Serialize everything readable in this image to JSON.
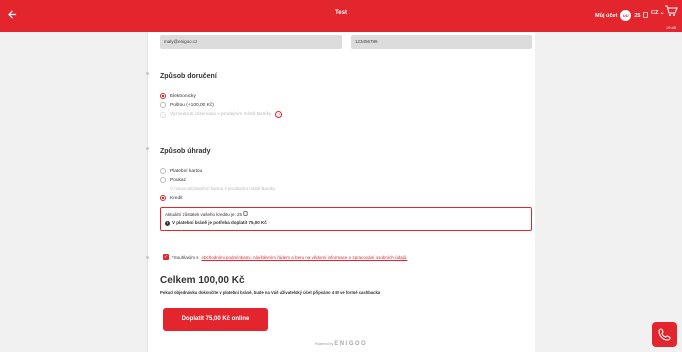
{
  "topbar": {
    "back_icon": "arrow-left-icon",
    "title": "Test",
    "account_label": "Můj účet",
    "avatar_initials": "UU",
    "credit": "25",
    "credit_icon": "credit-coin-icon",
    "language": "CZ",
    "cart_icon": "cart-icon",
    "cart_time": "19:48"
  },
  "contact": {
    "email": "maly@enigoo.cz",
    "phone": "123456789"
  },
  "delivery": {
    "title": "Způsob doručení",
    "options": [
      {
        "label": "Elektronicky",
        "selected": true,
        "disabled": false
      },
      {
        "label": "Poštou (+100,00 Kč)",
        "selected": false,
        "disabled": false
      },
      {
        "label": "Vyzvednutí rezervace v prodejním místě Baníky",
        "selected": false,
        "disabled": true
      }
    ]
  },
  "payment": {
    "title": "Způsob úhrady",
    "options": [
      {
        "label": "Platební kartou",
        "selected": false,
        "disabled": false
      },
      {
        "label": "Poukaz",
        "selected": false,
        "disabled": false
      },
      {
        "label": "V hotovosti/platební kartou v prodejním místě Baníky",
        "selected": false,
        "disabled": true
      },
      {
        "label": "Kredit",
        "selected": true,
        "disabled": false
      }
    ],
    "credit_balance_text": "Aktuální zůstatek vašeho kreditu je: 25",
    "credit_warning": "V platební bráně je potřeba doplatit 75,00 Kč"
  },
  "consent": {
    "prefix": "*Souhlasím s ",
    "link_text": "obchodními podmínkami, návštěvním řádem a beru na vědomí informace o zpracování osobních údajů.",
    "checked": true
  },
  "summary": {
    "total": "Celkem 100,00 Kč",
    "note": "Pokud objednávku dokončíte v platební bráně, bude na Váš uživatelský účet připsáno 4 ₪ ve formě cashbacku"
  },
  "pay_button": "Doplatit 75,00 Kč online",
  "footer": {
    "powered_by": "Powered by",
    "brand": "ENIGOO"
  },
  "colors": {
    "accent": "#e3262e",
    "background": "#f1f1f1",
    "card": "#ffffff"
  },
  "phone_icon": "phone-icon"
}
